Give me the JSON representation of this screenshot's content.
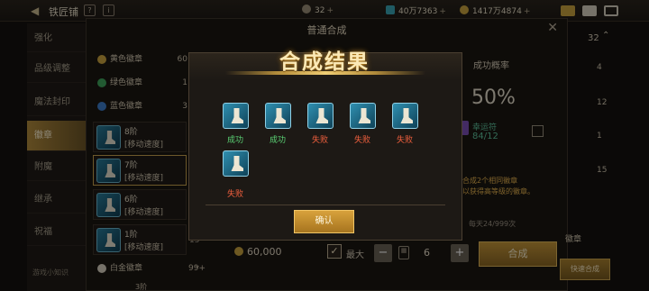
{
  "topbar": {
    "back_icon": "back-arrow-icon",
    "shop_title": "铁匠铺",
    "cur1_value": "32",
    "cur2_value": "40万7363",
    "cur3_value": "1417万4874",
    "plus": "+",
    "icons": {
      "bag": "bag-icon",
      "mail": "mail-icon",
      "menu": "menu-icon",
      "help": "help-icon"
    }
  },
  "nav": {
    "items": [
      "强化",
      "品级调整",
      "魔法封印",
      "徽章",
      "附魔",
      "继承",
      "祝福"
    ],
    "active_index": 3,
    "tip": "游戏小知识"
  },
  "panel": {
    "title": "普通合成",
    "close_icon": "close-icon",
    "categories": [
      {
        "label": "黄色徽章",
        "count": "60",
        "color": "#c9a33e"
      },
      {
        "label": "绿色徽章",
        "count": "1",
        "color": "#3fa45b"
      },
      {
        "label": "蓝色徽章",
        "count": "3",
        "color": "#3c7cc9"
      }
    ],
    "items": [
      {
        "tier": "8阶",
        "stat": "[移动速度]"
      },
      {
        "tier": "7阶",
        "stat": "[移动速度]"
      },
      {
        "tier": "6阶",
        "stat": "[移动速度]"
      },
      {
        "tier": "1阶",
        "stat": "[移动速度]",
        "side": "15"
      }
    ],
    "white": {
      "label": "白金徽章",
      "count": "99+"
    },
    "footer_fragment": "3阶",
    "rate_title": "成功概率",
    "rate_value": "50%",
    "luck_label": "幸运符",
    "luck_count": "84/12",
    "desc_line1": "合成2个相同徽章",
    "desc_line2": "以获得高等级的徽章。",
    "daily": "每天24/999次",
    "right_count": "32",
    "right_nums": [
      "4",
      "12",
      "1",
      "15"
    ],
    "right_badge": "徽章",
    "quick": "快速合成",
    "money": "60,000",
    "max_label": "最大",
    "minus": "−",
    "qty": "6",
    "plus": "+",
    "merge": "合成"
  },
  "modal": {
    "title": "合成结果",
    "results": [
      {
        "label": "成功",
        "ok": true
      },
      {
        "label": "成功",
        "ok": true
      },
      {
        "label": "失败",
        "ok": false
      },
      {
        "label": "失败",
        "ok": false
      },
      {
        "label": "失败",
        "ok": false
      },
      {
        "label": "失败",
        "ok": false
      }
    ],
    "confirm": "确认"
  }
}
